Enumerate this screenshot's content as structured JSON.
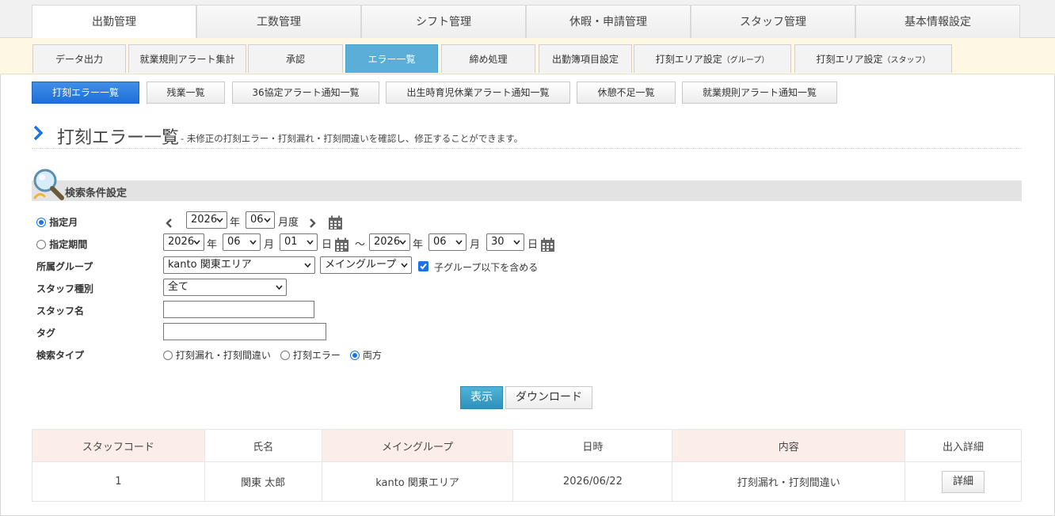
{
  "top_nav": [
    "出勤管理",
    "工数管理",
    "シフト管理",
    "休暇・申請管理",
    "スタッフ管理",
    "基本情報設定"
  ],
  "sub_nav": [
    "データ出力",
    "就業規則アラート集計",
    "承認",
    "エラー一覧",
    "締め処理",
    "出勤簿項目設定",
    "打刻エリア設定",
    "打刻エリア設定"
  ],
  "sub_nav_suffix": {
    "area_group": "（グループ）",
    "area_staff": "（スタッフ）"
  },
  "third_nav": [
    "打刻エラー一覧",
    "残業一覧",
    "36協定アラート通知一覧",
    "出生時育児休業アラート通知一覧",
    "休憩不足一覧",
    "就業規則アラート通知一覧"
  ],
  "page": {
    "title": "打刻エラー一覧",
    "description": "- 未修正の打刻エラー・打刻漏れ・打刻間違いを確認し、修正することができます。"
  },
  "search": {
    "header": "検索条件設定",
    "month_label": "指定月",
    "period_label": "指定期間",
    "group_label": "所属グループ",
    "staff_type_label": "スタッフ種別",
    "staff_name_label": "スタッフ名",
    "tag_label": "タグ",
    "search_type_label": "検索タイプ",
    "month": {
      "year": "2026",
      "year_unit": "年",
      "month": "06",
      "month_unit": "月度"
    },
    "period": {
      "from_year": "2026",
      "from_month": "06",
      "from_day": "01",
      "to_year": "2026",
      "to_month": "06",
      "to_day": "30",
      "year_unit": "年",
      "month_unit": "月",
      "day_unit": "日",
      "tilde": "～"
    },
    "group": {
      "area": "kanto 関東エリア",
      "main": "メイングループ",
      "include_sub": "子グループ以下を含める"
    },
    "staff_type": "全て",
    "staff_name": "",
    "tag": "",
    "search_type_options": [
      "打刻漏れ・打刻間違い",
      "打刻エラー",
      "両方"
    ],
    "show_button": "表示",
    "download_button": "ダウンロード"
  },
  "table": {
    "headers": [
      "スタッフコード",
      "氏名",
      "メイングループ",
      "日時",
      "内容",
      "出入詳細"
    ],
    "rows": [
      {
        "code": "1",
        "name": "関東 太郎",
        "group": "kanto 関東エリア",
        "date": "2026/06/22",
        "content": "打刻漏れ・打刻間違い",
        "detail": "詳細"
      }
    ]
  },
  "colors": {
    "accent": "#5aaed8",
    "primary": "#1e6fd8",
    "header_bg": "#fbeee8",
    "subnav_bg": "#fdf7e3"
  }
}
